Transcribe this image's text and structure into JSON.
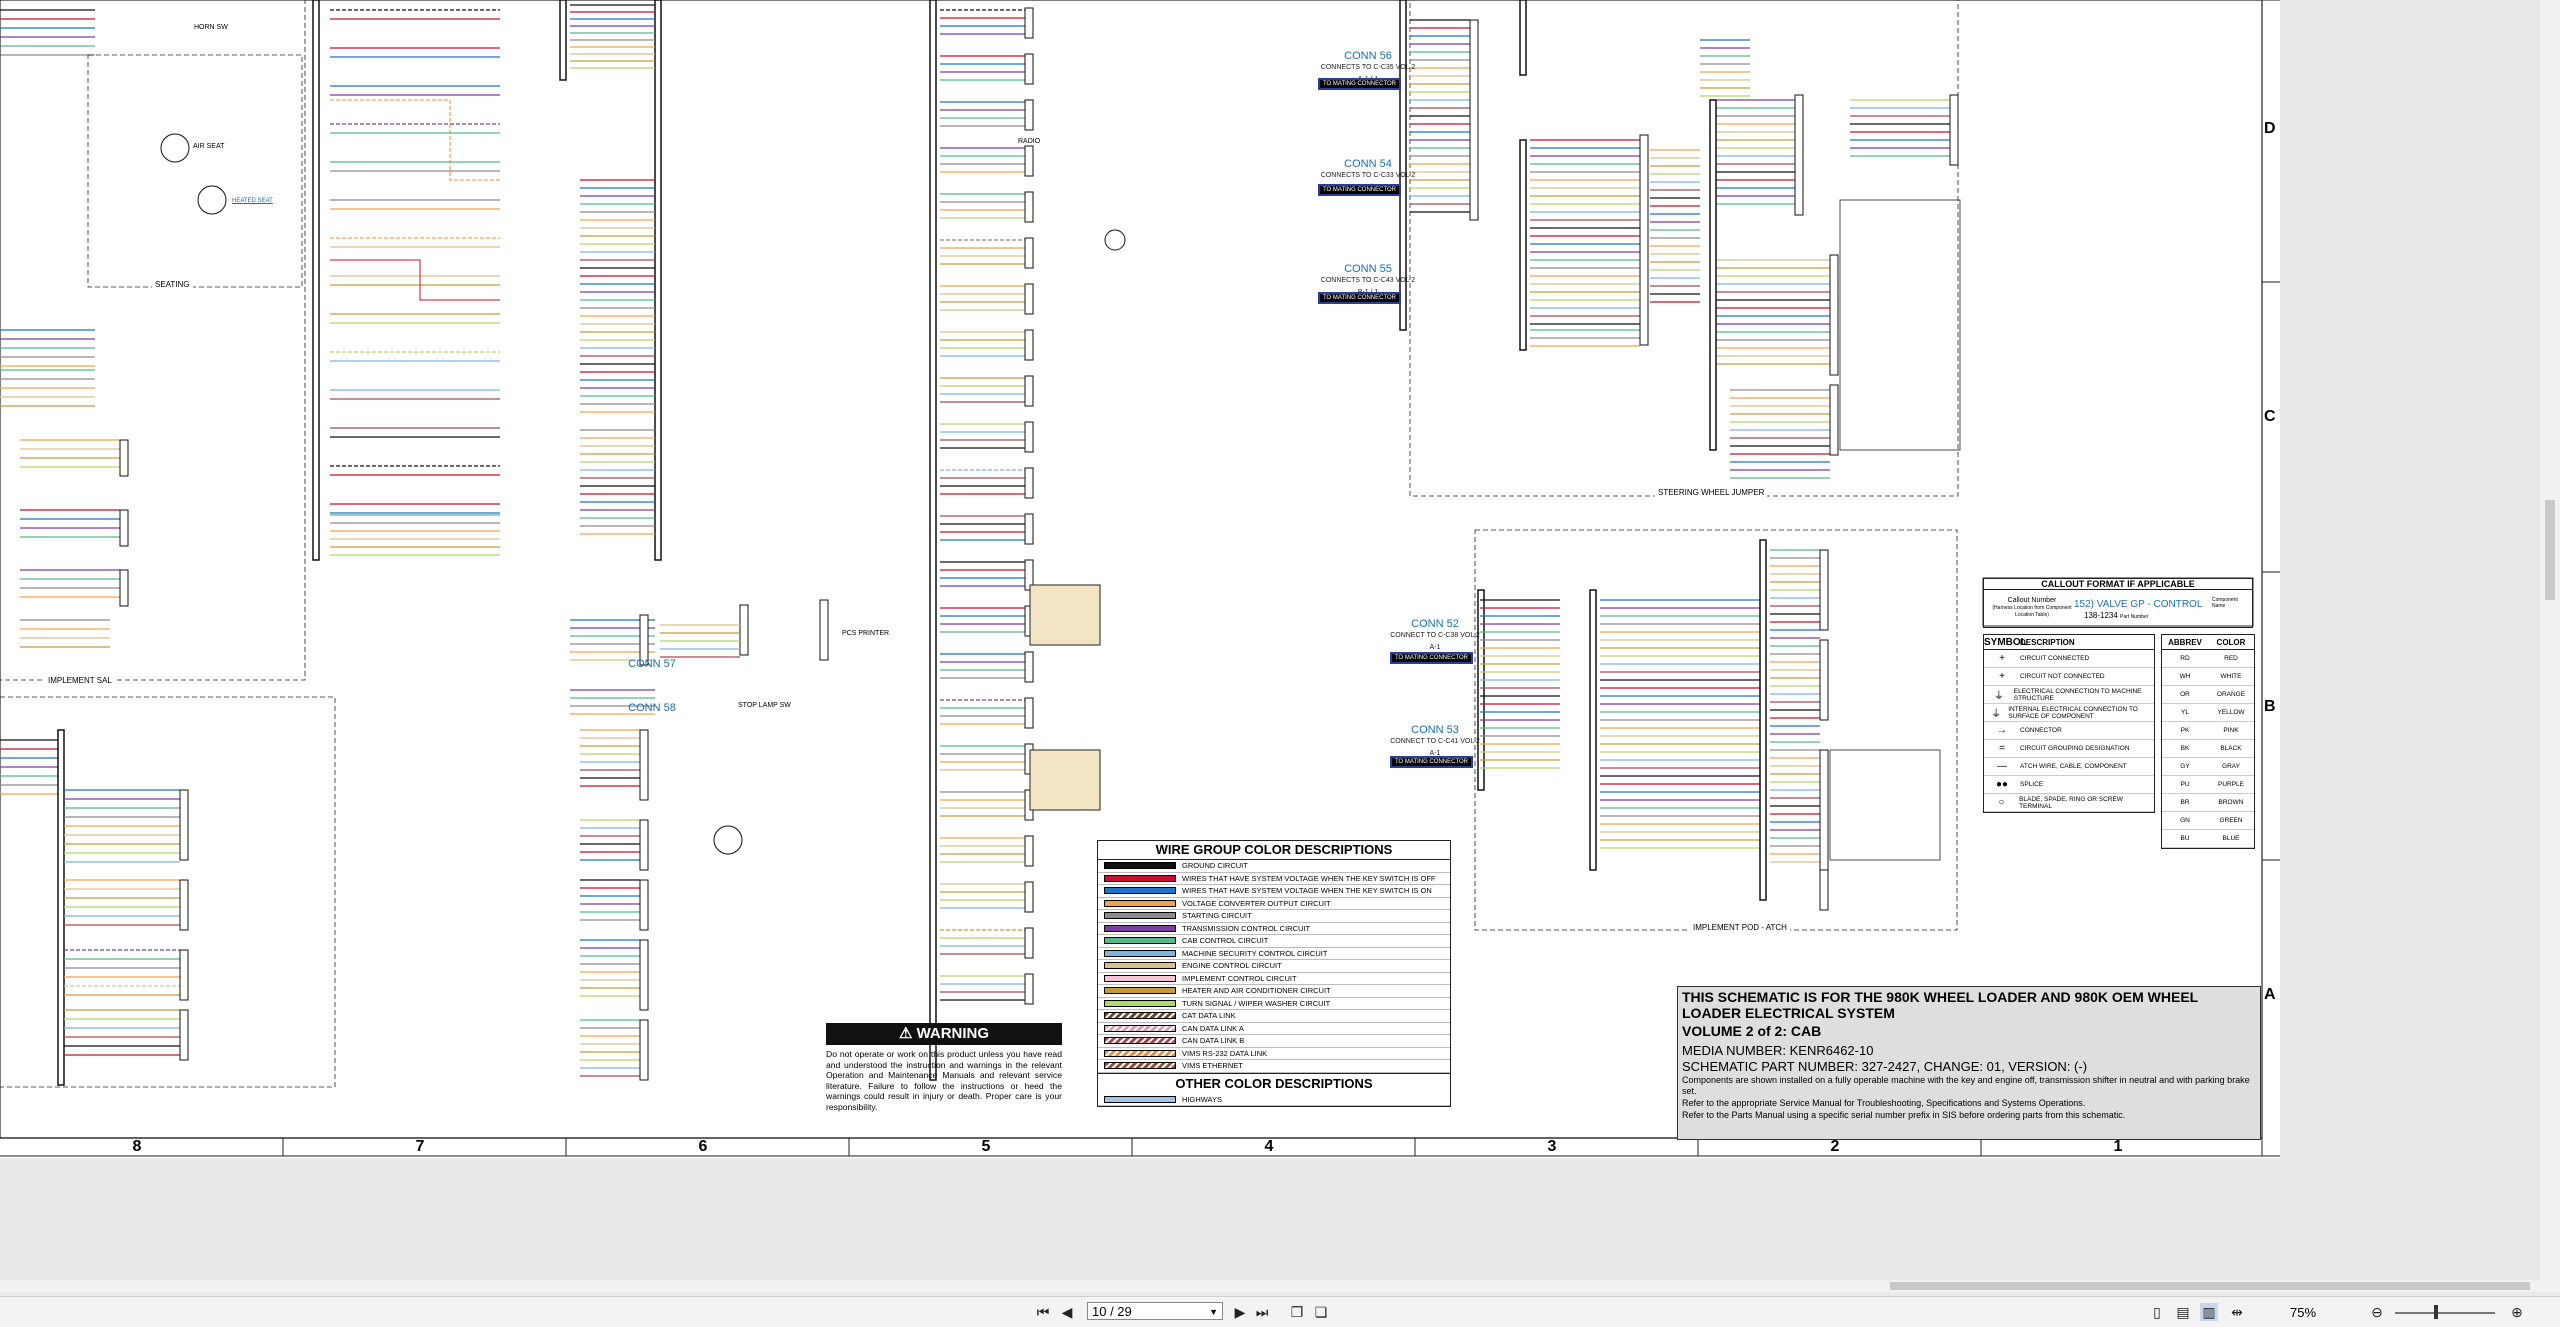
{
  "zones": {
    "d": "D",
    "c": "C",
    "b": "B",
    "a": "A"
  },
  "columns": [
    "8",
    "7",
    "6",
    "5",
    "4",
    "3",
    "2",
    "1"
  ],
  "connectors": [
    {
      "name": "CONN 56",
      "sub": "CONNECTS TO C-C35\nVOL 2 A-1 / 1",
      "tag": "TO MATING CONNECTOR"
    },
    {
      "name": "CONN 54",
      "sub": "CONNECTS TO C-C33\nVOL 2 B-1 / 1",
      "tag": "TO MATING CONNECTOR"
    },
    {
      "name": "CONN 55",
      "sub": "CONNECTS TO C-C43\nVOL 2 B-1 / 1",
      "tag": "TO MATING CONNECTOR"
    },
    {
      "name": "CONN 52",
      "sub": "CONNECT TO C-C38\nVOL 2 A-1",
      "tag": "TO MATING CONNECTOR"
    },
    {
      "name": "CONN 53",
      "sub": "CONNECT TO C-C41\nVOL 2 A-1",
      "tag": "TO MATING CONNECTOR"
    },
    {
      "name": "CONN 57",
      "sub": "",
      "tag": ""
    },
    {
      "name": "CONN 58",
      "sub": "",
      "tag": ""
    }
  ],
  "sections": {
    "seating": "SEATING",
    "implement_sal": "IMPLEMENT SAL",
    "steering_wheel_jumper": "STEERING WHEEL JUMPER",
    "implement_pod": "IMPLEMENT POD - ATCH"
  },
  "components": [
    "AIR SEAT",
    "HEATED SEAT",
    "PCS PRINTER",
    "STOP LAMP SW",
    "RADIO",
    "HORN SW"
  ],
  "warning": {
    "title": "WARNING",
    "text": "Do not operate or work on this product unless you have read and understood the instruction and warnings in the relevant Operation and Maintenance Manuals and relevant service literature. Failure to follow the instructions or heed the warnings could result in injury or death. Proper care is your responsibility."
  },
  "wire_groups": {
    "title": "WIRE GROUP COLOR DESCRIPTIONS",
    "rows": [
      {
        "label": "GROUND CIRCUIT",
        "color": "#111111"
      },
      {
        "label": "WIRES THAT HAVE SYSTEM VOLTAGE WHEN THE KEY SWITCH IS OFF",
        "color": "#c8102e"
      },
      {
        "label": "WIRES THAT HAVE SYSTEM VOLTAGE WHEN THE KEY SWITCH IS ON",
        "color": "#1a75c8"
      },
      {
        "label": "VOLTAGE CONVERTER OUTPUT CIRCUIT",
        "color": "#f2a24c"
      },
      {
        "label": "STARTING CIRCUIT",
        "color": "#8c8c8c"
      },
      {
        "label": "TRANSMISSION CONTROL CIRCUIT",
        "color": "#7b3fa0"
      },
      {
        "label": "CAB CONTROL CIRCUIT",
        "color": "#55b98a"
      },
      {
        "label": "MACHINE SECURITY CONTROL CIRCUIT",
        "color": "#7fb3e0"
      },
      {
        "label": "ENGINE CONTROL CIRCUIT",
        "color": "#d9c089"
      },
      {
        "label": "IMPLEMENT CONTROL CIRCUIT",
        "color": "#f4c6d5"
      },
      {
        "label": "HEATER AND AIR CONDITIONER CIRCUIT",
        "color": "#c79a3a"
      },
      {
        "label": "TURN SIGNAL / WIPER WASHER CIRCUIT",
        "color": "#b0d86a"
      },
      {
        "label": "CAT DATA LINK",
        "color": "#6b4a2b"
      },
      {
        "label": "CAN DATA LINK A",
        "color": "#d5a0b5"
      },
      {
        "label": "CAN DATA LINK B",
        "color": "#a34a56"
      },
      {
        "label": "VIMS RS-232 DATA LINK",
        "color": "#f08a3c"
      },
      {
        "label": "VIMS ETHERNET",
        "color": "#9b4e2e"
      }
    ],
    "other_title": "OTHER COLOR DESCRIPTIONS",
    "other_rows": [
      {
        "label": "HIGHWAYS",
        "color": "#9ec4e8"
      }
    ]
  },
  "legend": {
    "callout_title": "CALLOUT FORMAT IF APPLICABLE",
    "callout_number": "Callout Number",
    "callout_number_sub": "(Harness Location from Component Location Table)",
    "callout_example": "152) VALVE GP - CONTROL",
    "callout_part": "138-1234",
    "callout_part_label": "Part Number",
    "callout_desc": "Component Name",
    "symbol_header": "SYMBOL",
    "description_header": "DESCRIPTION",
    "symbols": [
      {
        "s": "+",
        "d": "CIRCUIT CONNECTED"
      },
      {
        "s": "+",
        "d": "CIRCUIT NOT CONNECTED"
      },
      {
        "s": "⏚",
        "d": "ELECTRICAL CONNECTION TO MACHINE STRUCTURE"
      },
      {
        "s": "⏚",
        "d": "INTERNAL ELECTRICAL CONNECTION TO SURFACE OF COMPONENT"
      },
      {
        "s": "→",
        "d": "CONNECTOR"
      },
      {
        "s": "=",
        "d": "CIRCUIT GROUPING DESIGNATION"
      },
      {
        "s": "—",
        "d": "ATCH WIRE, CABLE, COMPONENT"
      },
      {
        "s": "●●",
        "d": "SPLICE"
      },
      {
        "s": "○",
        "d": "BLADE, SPADE, RING OR SCREW TERMINAL"
      }
    ],
    "abbrev_header": "ABBREV",
    "color_header": "COLOR",
    "abbrevs": [
      {
        "a": "RD",
        "c": "RED"
      },
      {
        "a": "WH",
        "c": "WHITE"
      },
      {
        "a": "OR",
        "c": "ORANGE"
      },
      {
        "a": "YL",
        "c": "YELLOW"
      },
      {
        "a": "PK",
        "c": "PINK"
      },
      {
        "a": "BK",
        "c": "BLACK"
      },
      {
        "a": "GY",
        "c": "GRAY"
      },
      {
        "a": "PU",
        "c": "PURPLE"
      },
      {
        "a": "BR",
        "c": "BROWN"
      },
      {
        "a": "GN",
        "c": "GREEN"
      },
      {
        "a": "BU",
        "c": "BLUE"
      }
    ]
  },
  "title_block": {
    "line1": "THIS SCHEMATIC IS FOR THE 980K WHEEL LOADER AND 980K OEM WHEEL LOADER ELECTRICAL SYSTEM",
    "line2": "VOLUME 2 of 2: CAB",
    "media": "MEDIA NUMBER: KENR6462-10",
    "part": "SCHEMATIC PART NUMBER: 327-2427, CHANGE: 01, VERSION: (-)",
    "note1": "Components are shown installed on a fully operable machine with the key and engine off, transmission shifter in neutral and with parking brake set.",
    "note2": "Refer to the appropriate Service Manual for Troubleshooting, Specifications and Systems Operations.",
    "note3": "Refer to the Parts Manual using a specific serial number prefix in SIS before ordering parts from this schematic."
  },
  "toolbar": {
    "page": "10 / 29",
    "zoom": "75%"
  }
}
